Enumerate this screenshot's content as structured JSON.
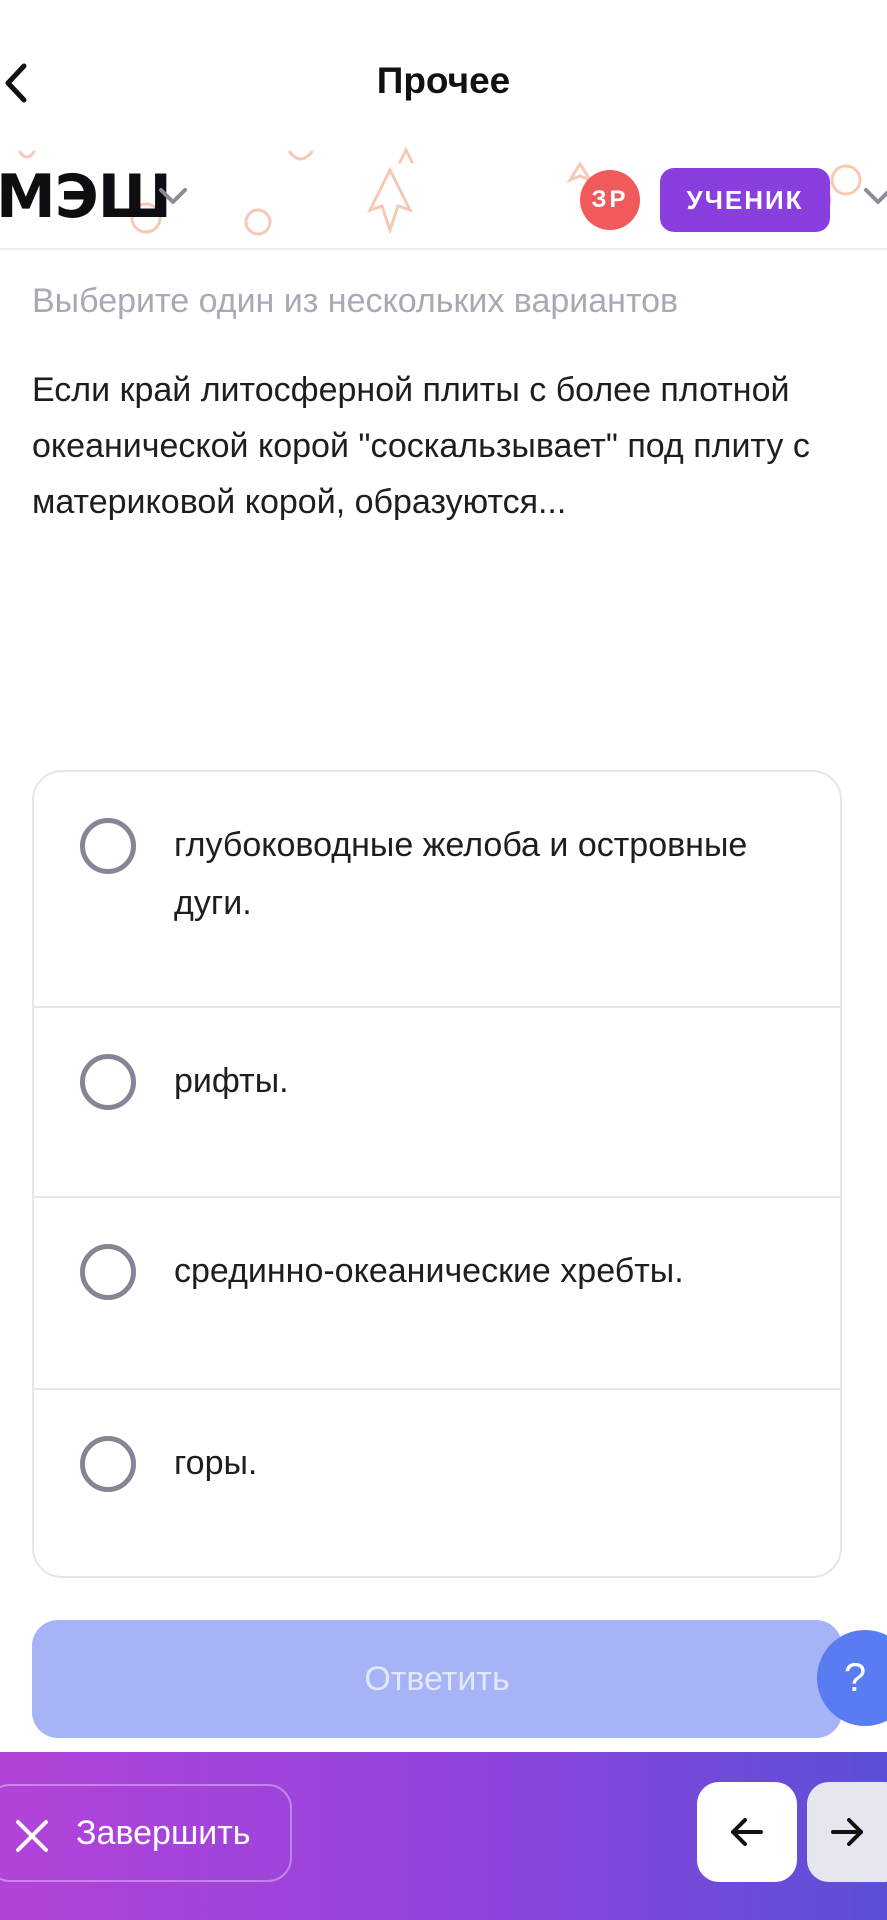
{
  "nav": {
    "back_icon": "chevron-left-icon",
    "title": "Прочее"
  },
  "header": {
    "logo": "МЭШ",
    "avatar_initials": "ЗР",
    "role_label": "УЧЕНИК"
  },
  "question": {
    "hint": "Выберите один из нескольких вариантов",
    "text": "Если край литосферной плиты с более плотной океанической корой \"соскальзывает\" под плиту с материковой корой, образуются..."
  },
  "options": [
    {
      "label": "глубоководные желоба и островные дуги.",
      "selected": false
    },
    {
      "label": "рифты.",
      "selected": false
    },
    {
      "label": "срединно-океанические хребты.",
      "selected": false
    },
    {
      "label": "горы.",
      "selected": false
    }
  ],
  "answer_button": {
    "label": "Ответить"
  },
  "help_button": {
    "label": "?"
  },
  "footer": {
    "finish_label": "Завершить",
    "prev_icon": "arrow-left-icon",
    "next_icon": "arrow-right-icon"
  },
  "colors": {
    "accent": "#8a3ee0",
    "avatar": "#f05a5a",
    "answer_disabled": "#a6b3f7",
    "help": "#5a7cf2"
  }
}
